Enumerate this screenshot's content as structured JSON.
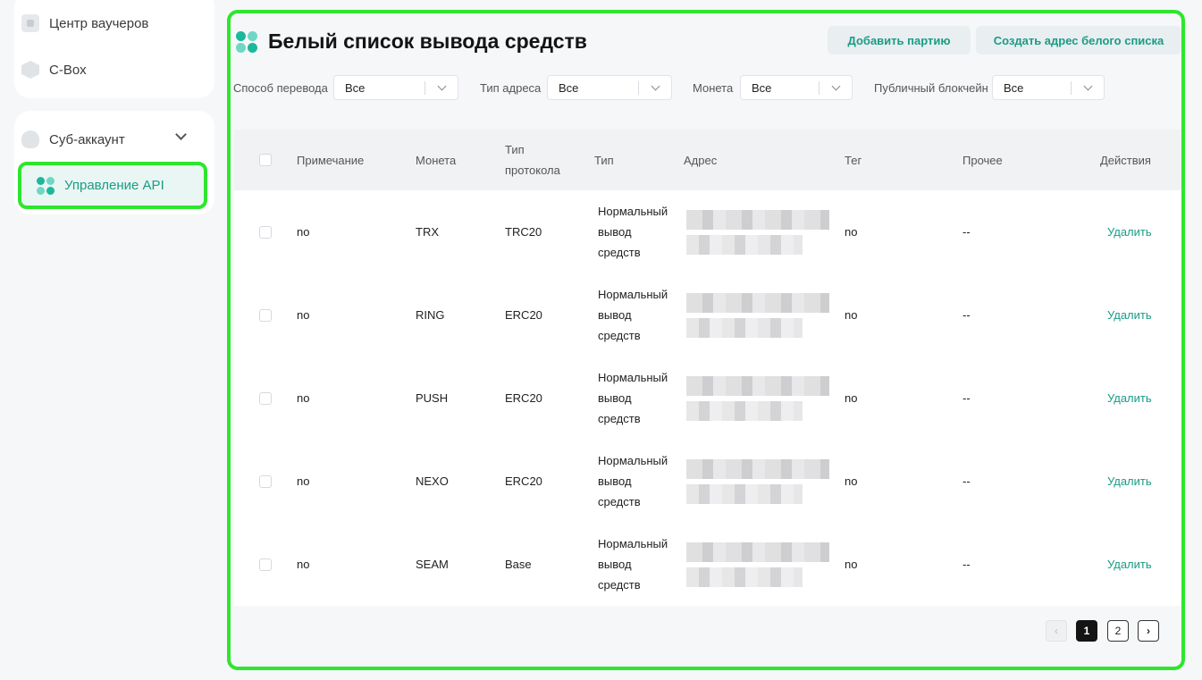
{
  "sidebar": {
    "items": [
      {
        "label": "Центр ваучеров",
        "icon": "voucher-icon"
      },
      {
        "label": "C-Box",
        "icon": "box-icon"
      },
      {
        "label": "Суб-аккаунт",
        "icon": "sub-account-icon"
      },
      {
        "label": "Управление API",
        "icon": "api-grid-icon",
        "active": true
      }
    ]
  },
  "header": {
    "title": "Белый список вывода средств",
    "add_batch_label": "Добавить партию",
    "create_address_label": "Создать адрес белого списка"
  },
  "filters": {
    "transfer_method": {
      "label": "Способ перевода",
      "value": "Все"
    },
    "address_type": {
      "label": "Тип адреса",
      "value": "Все"
    },
    "coin": {
      "label": "Монета",
      "value": "Все"
    },
    "blockchain": {
      "label": "Публичный блокчейн",
      "value": "Все"
    }
  },
  "table": {
    "headers": {
      "note": "Примечание",
      "coin": "Монета",
      "protocol_1": "Тип",
      "protocol_2": "протокола",
      "type": "Тип",
      "address": "Адрес",
      "tag": "Тег",
      "other": "Прочее",
      "actions": "Действия"
    },
    "rows": [
      {
        "note": "no",
        "coin": "TRX",
        "protocol": "TRC20",
        "type1": "Нормальный",
        "type2": "вывод",
        "type3": "средств",
        "tag": "no",
        "other": "--",
        "action": "Удалить"
      },
      {
        "note": "no",
        "coin": "RING",
        "protocol": "ERC20",
        "type1": "Нормальный",
        "type2": "вывод",
        "type3": "средств",
        "tag": "no",
        "other": "--",
        "action": "Удалить"
      },
      {
        "note": "no",
        "coin": "PUSH",
        "protocol": "ERC20",
        "type1": "Нормальный",
        "type2": "вывод",
        "type3": "средств",
        "tag": "no",
        "other": "--",
        "action": "Удалить"
      },
      {
        "note": "no",
        "coin": "NEXO",
        "protocol": "ERC20",
        "type1": "Нормальный",
        "type2": "вывод",
        "type3": "средств",
        "tag": "no",
        "other": "--",
        "action": "Удалить"
      },
      {
        "note": "no",
        "coin": "SEAM",
        "protocol": "Base",
        "type1": "Нормальный",
        "type2": "вывод",
        "type3": "средств",
        "tag": "no",
        "other": "--",
        "action": "Удалить"
      }
    ]
  },
  "pagination": {
    "prev_icon": "chevron-left-icon",
    "pages": [
      "1",
      "2"
    ],
    "current": "1",
    "next_icon": "chevron-right-icon"
  },
  "colors": {
    "accent": "#1a9c86",
    "highlight": "#2ee62e"
  }
}
